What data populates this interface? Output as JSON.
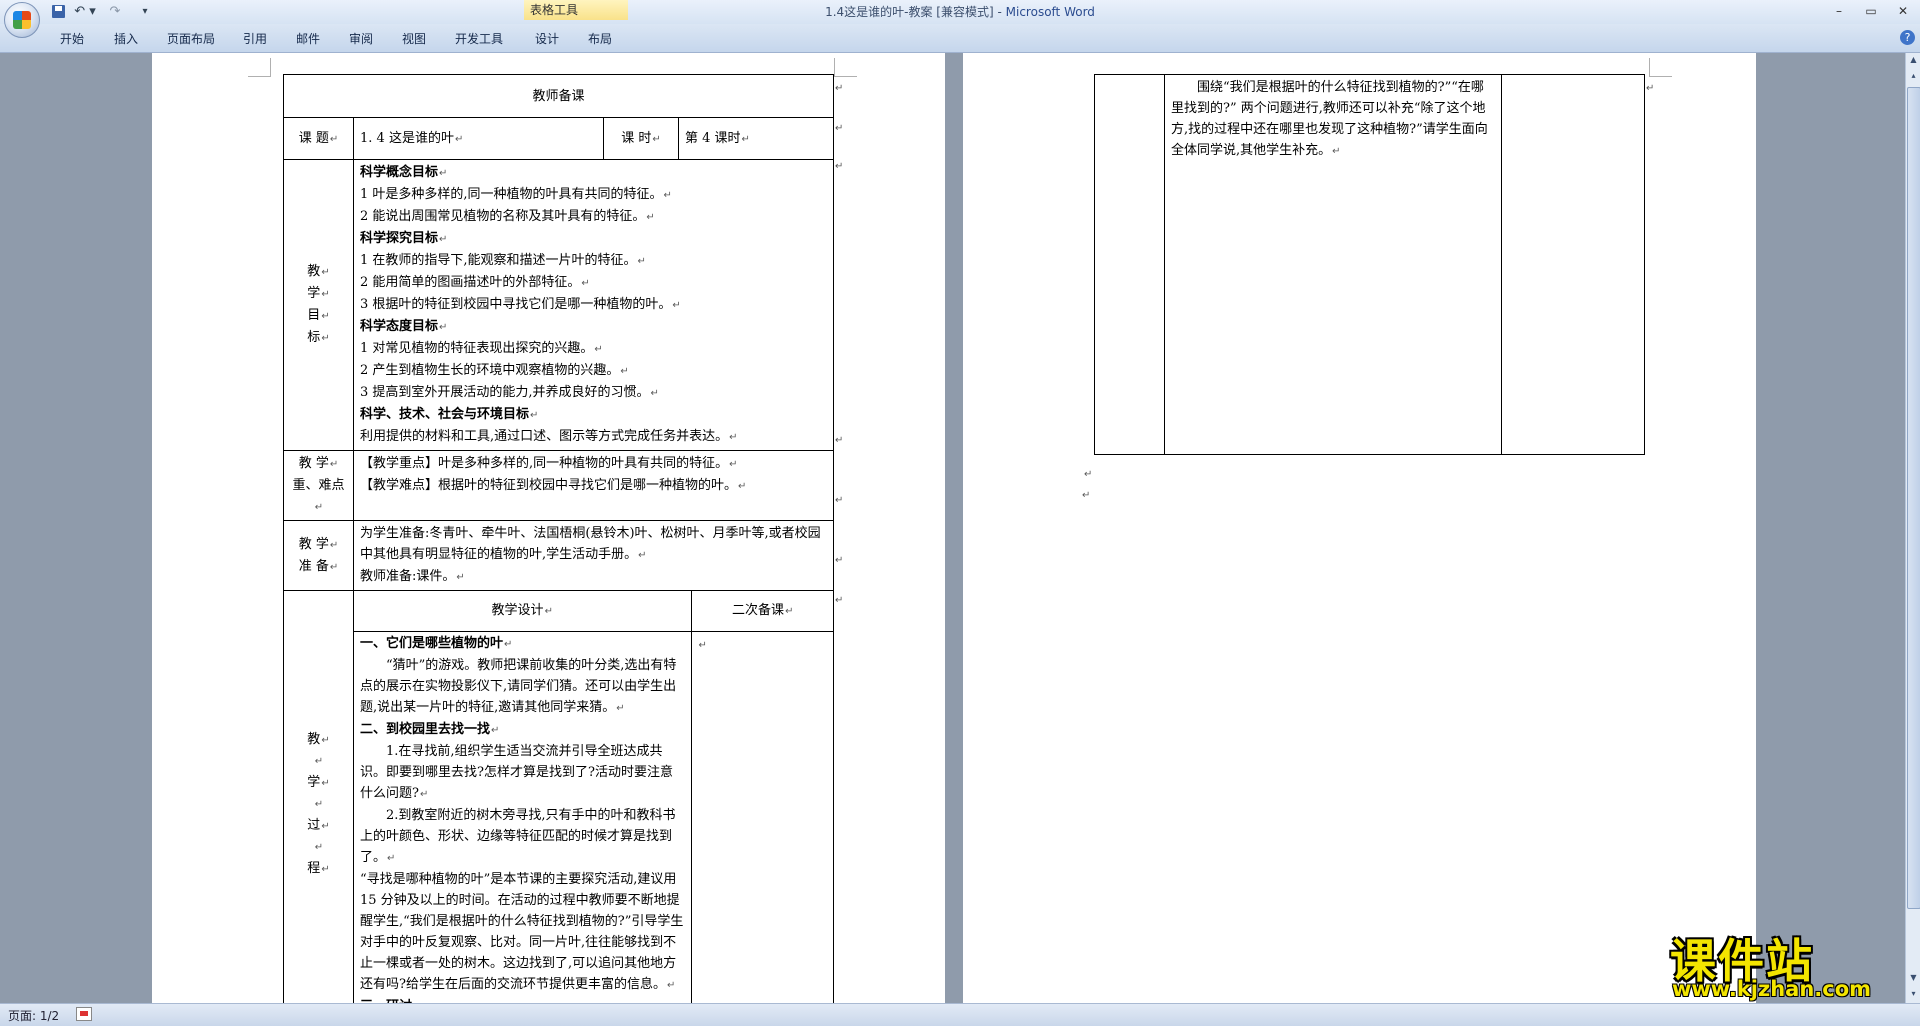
{
  "window": {
    "title_doc": "1.4这是谁的叶-教案 [兼容模式] - ",
    "title_app": "Microsoft Word",
    "context_tab": "表格工具"
  },
  "quick_access": {
    "undo": "↶ ▾",
    "redo": "↷",
    "customize": "▾"
  },
  "window_controls": {
    "minimize": "–",
    "maximize": "▭",
    "close": "✕"
  },
  "ribbon_tabs": [
    "开始",
    "插入",
    "页面布局",
    "引用",
    "邮件",
    "审阅",
    "视图",
    "开发工具",
    "设计",
    "布局"
  ],
  "help": "?",
  "mark": "↵",
  "page1": {
    "table": {
      "title": "教师备课",
      "row_topic": {
        "label": "课  题",
        "value": "1. 4 这是谁的叶",
        "period_label": "课   时",
        "period_value": "第 4 课时"
      },
      "goals": {
        "label": [
          "教",
          "学",
          "目",
          "标"
        ],
        "lines": [
          {
            "text": "科学概念目标",
            "bold": true
          },
          {
            "text": "1 叶是多种多样的,同一种植物的叶具有共同的特征。",
            "bold": false
          },
          {
            "text": "2 能说出周围常见植物的名称及其叶具有的特征。",
            "bold": false
          },
          {
            "text": "科学探究目标",
            "bold": true
          },
          {
            "text": "1 在教师的指导下,能观察和描述一片叶的特征。",
            "bold": false
          },
          {
            "text": "2 能用简单的图画描述叶的外部特征。",
            "bold": false
          },
          {
            "text": "3 根据叶的特征到校园中寻找它们是哪一种植物的叶。",
            "bold": false
          },
          {
            "text": "科学态度目标",
            "bold": true
          },
          {
            "text": "1 对常见植物的特征表现出探究的兴趣。",
            "bold": false
          },
          {
            "text": "2 产生到植物生长的环境中观察植物的兴趣。",
            "bold": false
          },
          {
            "text": "3 提高到室外开展活动的能力,并养成良好的习惯。",
            "bold": false
          },
          {
            "text": "科学、技术、社会与环境目标",
            "bold": true
          },
          {
            "text": "利用提供的材料和工具,通过口述、图示等方式完成任务并表达。",
            "bold": false
          }
        ]
      },
      "key_points": {
        "label": [
          "教 学",
          "重、难点"
        ],
        "lines": [
          {
            "tag": "【教学重点】",
            "text": "叶是多种多样的,同一种植物的叶具有共同的特征。"
          },
          {
            "tag": "【教学难点】",
            "text": "根据叶的特征到校园中寻找它们是哪一种植物的叶。"
          }
        ]
      },
      "preparation": {
        "label": [
          "教 学",
          "准 备"
        ],
        "lines": [
          "为学生准备:冬青叶、牵牛叶、法国梧桐(悬铃木)叶、松树叶、月季叶等,或者校园中其他具有明显特征的植物的叶,学生活动手册。",
          "教师准备:课件。"
        ]
      },
      "process": {
        "label": [
          "教",
          "学",
          "过",
          "程"
        ],
        "header_design": "教学设计",
        "header_second": "二次备课",
        "blocks": [
          {
            "text": "一、它们是哪些植物的叶",
            "style": "bold"
          },
          {
            "text": "“猜叶”的游戏。教师把课前收集的叶分类,选出有特点的展示在实物投影仪下,请同学们猜。还可以由学生出题,说出某一片叶的特征,邀请其他同学来猜。",
            "style": "indent"
          },
          {
            "text": "二、到校园里去找一找",
            "style": "bold"
          },
          {
            "text": "1.在寻找前,组织学生适当交流并引导全班达成共识。即要到哪里去找?怎样才算是找到了?活动时要注意什么问题?",
            "style": "indent"
          },
          {
            "text": "2.到教室附近的树木旁寻找,只有手中的叶和教科书上的叶颜色、形状、边缘等特征匹配的时候才算是找到了。",
            "style": "indent"
          },
          {
            "text": "“寻找是哪种植物的叶”是本节课的主要探究活动,建议用 15 分钟及以上的时间。在活动的过程中教师要不断地提醒学生,“我们是根据叶的什么特征找到植物的?”引导学生对手中的叶反复观察、比对。同一片叶,往往能够找到不止一棵或者一处的树木。这边找到了,可以追问其他地方还有吗?给学生在后面的交流环节提供更丰富的信息。",
            "style": "plain"
          },
          {
            "text": "三、研讨",
            "style": "bold"
          }
        ]
      }
    }
  },
  "page2": {
    "text": "围绕“我们是根据叶的什么特征找到植物的?”“在哪里找到的?” 两个问题进行,教师还可以补充“除了这个地方,找的过程中还在哪里也发现了这种植物?”请学生面向全体同学说,其他学生补充。"
  },
  "status": {
    "page": "页面: 1/2"
  },
  "watermark": {
    "name": "课件站",
    "url": "www.kjzhan.com"
  }
}
